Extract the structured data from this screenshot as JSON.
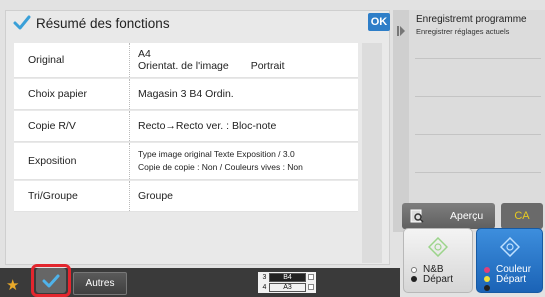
{
  "summary": {
    "title": "Résumé des fonctions",
    "ok_label": "OK",
    "rows": [
      {
        "label": "Original",
        "value_line1": "A4",
        "value_line2a": "Orientat. de l'image",
        "value_line2b": "Portrait"
      },
      {
        "label": "Choix papier",
        "value": "Magasin 3 B4   Ordin."
      },
      {
        "label": "Copie R/V",
        "value": "Recto→Recto ver. : Bloc-note"
      },
      {
        "label": "Exposition",
        "value_line1": "Type image original  Texte Exposition / 3.0",
        "value_line2": "Copie de copie : Non /    Couleurs vives :  Non"
      },
      {
        "label": "Tri/Groupe",
        "value": "Groupe"
      }
    ]
  },
  "program_panel": {
    "title": "Enregistremt programme",
    "subtitle": "Enregistrer réglages actuels"
  },
  "actions": {
    "apercu_label": "Aperçu",
    "ca_label": "CA",
    "bw_start_line1": "N&B",
    "bw_start_line2": "Départ",
    "color_start_line1": "Couleur",
    "color_start_line2": "Départ"
  },
  "bottom_bar": {
    "autres_label": "Autres",
    "trays": [
      {
        "number": "3",
        "size": "B4",
        "selected": true
      },
      {
        "number": "4",
        "size": "A3",
        "selected": false
      }
    ]
  },
  "colors": {
    "accent_blue": "#2e7ec8",
    "ca_yellow": "#e8cb20",
    "highlight_red": "#e3262e",
    "color_start_blue": "#1b63b6"
  }
}
